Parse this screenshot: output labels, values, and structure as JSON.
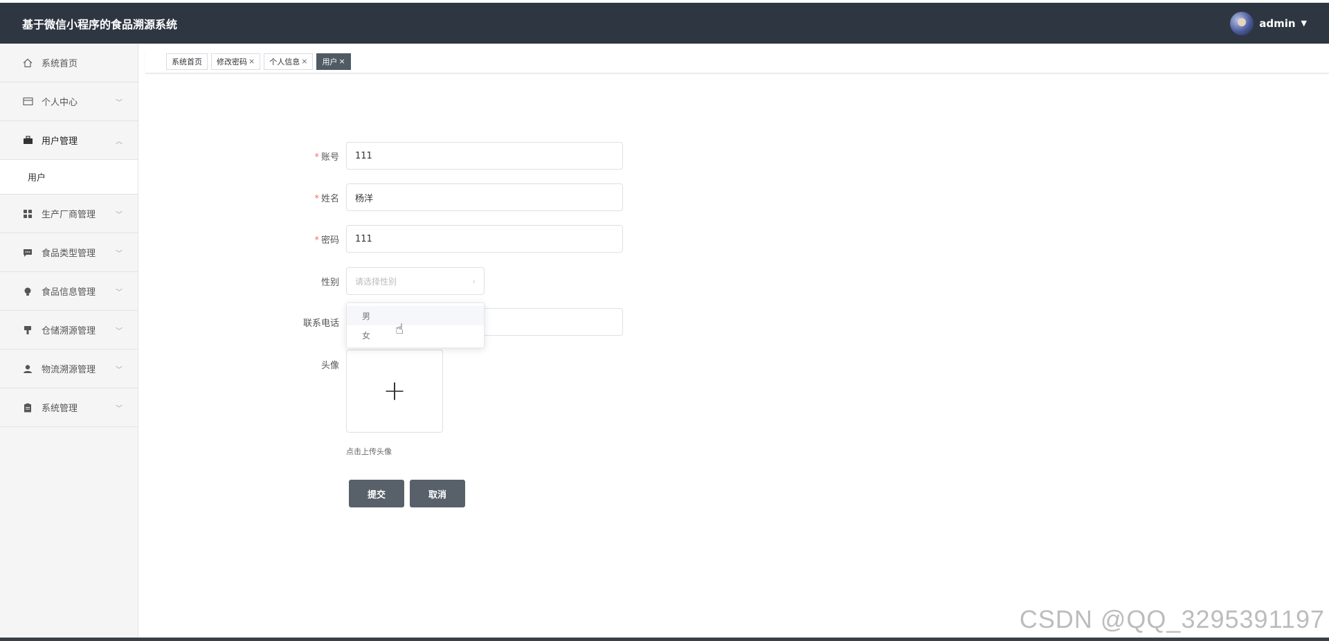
{
  "header": {
    "title": "基于微信小程序的食品溯源系统",
    "username": "admin"
  },
  "sidebar": {
    "items": [
      {
        "label": "系统首页",
        "icon": "home-icon"
      },
      {
        "label": "个人中心",
        "icon": "card-icon"
      },
      {
        "label": "用户管理",
        "icon": "briefcase-icon",
        "open": true
      },
      {
        "label": "生产厂商管理",
        "icon": "grid-icon"
      },
      {
        "label": "食品类型管理",
        "icon": "chat-icon"
      },
      {
        "label": "食品信息管理",
        "icon": "bulb-icon"
      },
      {
        "label": "仓储溯源管理",
        "icon": "stamp-icon"
      },
      {
        "label": "物流溯源管理",
        "icon": "user-icon"
      },
      {
        "label": "系统管理",
        "icon": "clipboard-icon"
      }
    ],
    "sub_user": "用户"
  },
  "tabs": [
    {
      "label": "系统首页",
      "closable": false
    },
    {
      "label": "修改密码",
      "closable": true
    },
    {
      "label": "个人信息",
      "closable": true
    },
    {
      "label": "用户",
      "closable": true,
      "active": true
    }
  ],
  "form": {
    "account_label": "账号",
    "account_value": "111",
    "name_label": "姓名",
    "name_value": "杨洋",
    "password_label": "密码",
    "password_value": "111",
    "gender_label": "性别",
    "gender_placeholder": "请选择性别",
    "gender_options": [
      "男",
      "女"
    ],
    "phone_label": "联系电话",
    "avatar_label": "头像",
    "upload_tip": "点击上传头像",
    "submit_label": "提交",
    "cancel_label": "取消"
  },
  "watermark": "CSDN @QQ_3295391197",
  "colors": {
    "header_bg": "#2e3741",
    "active_tab": "#4f5a63",
    "button_bg": "#58616a",
    "required": "#f56c6c"
  }
}
